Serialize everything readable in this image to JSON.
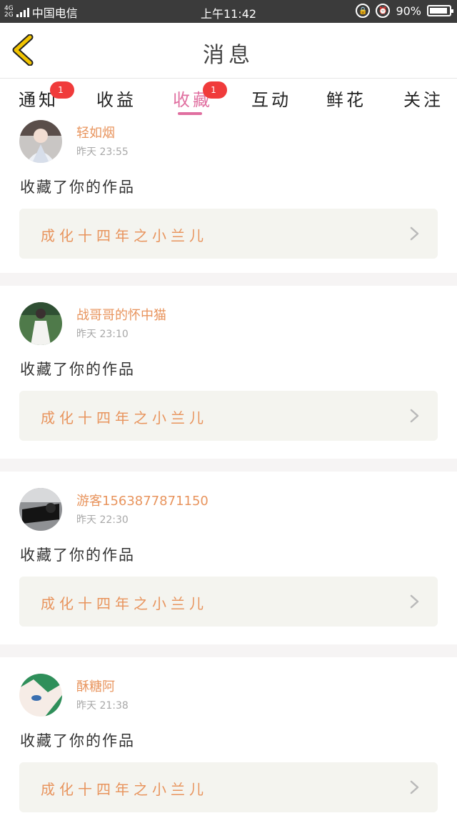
{
  "status_bar": {
    "net_top": "4G",
    "net_bottom": "2G",
    "carrier": "中国电信",
    "time": "上午11:42",
    "battery": "90%"
  },
  "header": {
    "title": "消息"
  },
  "tabs": [
    {
      "label": "通知",
      "badge": "1"
    },
    {
      "label": "收益"
    },
    {
      "label": "收藏",
      "badge": "1",
      "active": true
    },
    {
      "label": "互动"
    },
    {
      "label": "鲜花"
    },
    {
      "label": "关注"
    }
  ],
  "items": [
    {
      "name": "轻如烟",
      "time": "昨天 23:55",
      "action": "收藏了你的作品",
      "work": "成化十四年之小兰儿"
    },
    {
      "name": "战哥哥的怀中猫",
      "time": "昨天 23:10",
      "action": "收藏了你的作品",
      "work": "成化十四年之小兰儿"
    },
    {
      "name": "游客1563877871150",
      "time": "昨天 22:30",
      "action": "收藏了你的作品",
      "work": "成化十四年之小兰儿"
    },
    {
      "name": "酥糖阿",
      "time": "昨天 21:38",
      "action": "收藏了你的作品",
      "work": "成化十四年之小兰儿"
    }
  ],
  "colors": {
    "accent": "#e06fa0",
    "name": "#e8945d",
    "badge": "#f03b3b",
    "back_icon": "#f2c400"
  }
}
